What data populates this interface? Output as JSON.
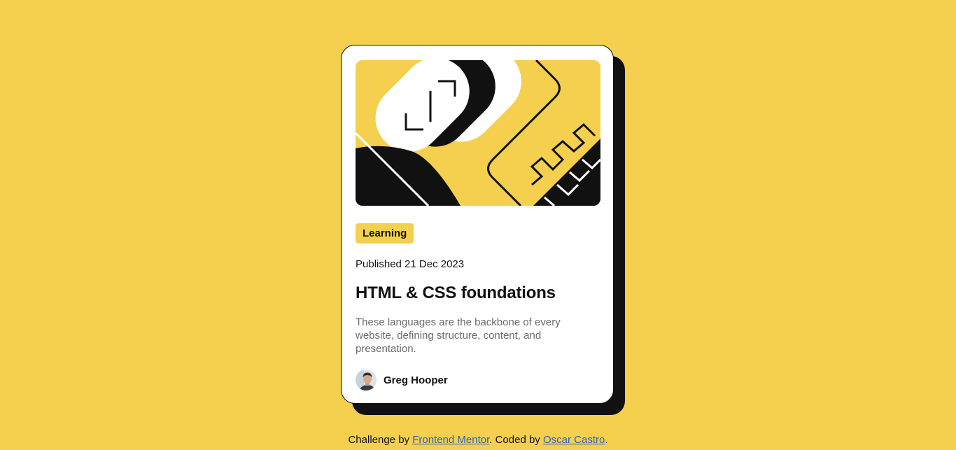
{
  "colors": {
    "background": "#F4D04E",
    "card": "#FFFFFF",
    "ink": "#111111",
    "muted_text": "#6B6B6B",
    "link": "#2E5FB8"
  },
  "card": {
    "illustration_icon": "abstract-illustration",
    "tag_label": "Learning",
    "published": "Published 21 Dec 2023",
    "title": "HTML & CSS foundations",
    "description": "These languages are the backbone of every website, defining structure, content, and presentation.",
    "author": {
      "avatar_icon": "avatar-photo",
      "name": "Greg Hooper"
    }
  },
  "attribution": {
    "prefix": "Challenge by ",
    "challenge_link": "Frontend Mentor",
    "middle": ". Coded by ",
    "author_link": "Oscar Castro",
    "suffix": "."
  }
}
